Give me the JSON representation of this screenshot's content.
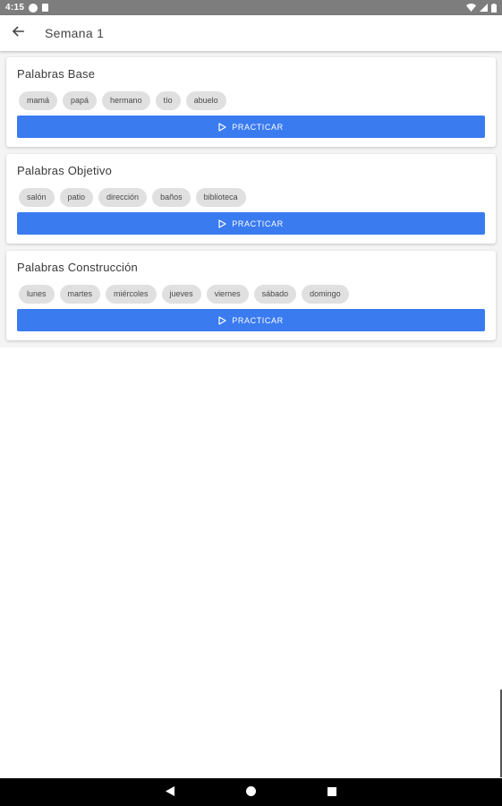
{
  "status_bar": {
    "time": "4:15"
  },
  "app_bar": {
    "title": "Semana 1"
  },
  "cards": [
    {
      "title": "Palabras Base",
      "words": [
        "mamá",
        "papá",
        "hermano",
        "tío",
        "abuelo"
      ],
      "button_label": "PRACTICAR"
    },
    {
      "title": "Palabras Objetivo",
      "words": [
        "salón",
        "patio",
        "dirección",
        "baños",
        "biblioteca"
      ],
      "button_label": "PRACTICAR"
    },
    {
      "title": "Palabras Construcción",
      "words": [
        "lunes",
        "martes",
        "miércoles",
        "jueves",
        "viernes",
        "sábado",
        "domingo"
      ],
      "button_label": "PRACTICAR"
    }
  ],
  "colors": {
    "accent": "#3a7bf0",
    "chip_bg": "#e0e0e0",
    "status_bar": "#7d7d7d",
    "nav_bar": "#000000"
  },
  "icons": {
    "back": "arrow-left-icon",
    "play": "play-outline-icon",
    "nav_back": "triangle-back-icon",
    "nav_home": "circle-home-icon",
    "nav_recents": "square-recents-icon"
  }
}
